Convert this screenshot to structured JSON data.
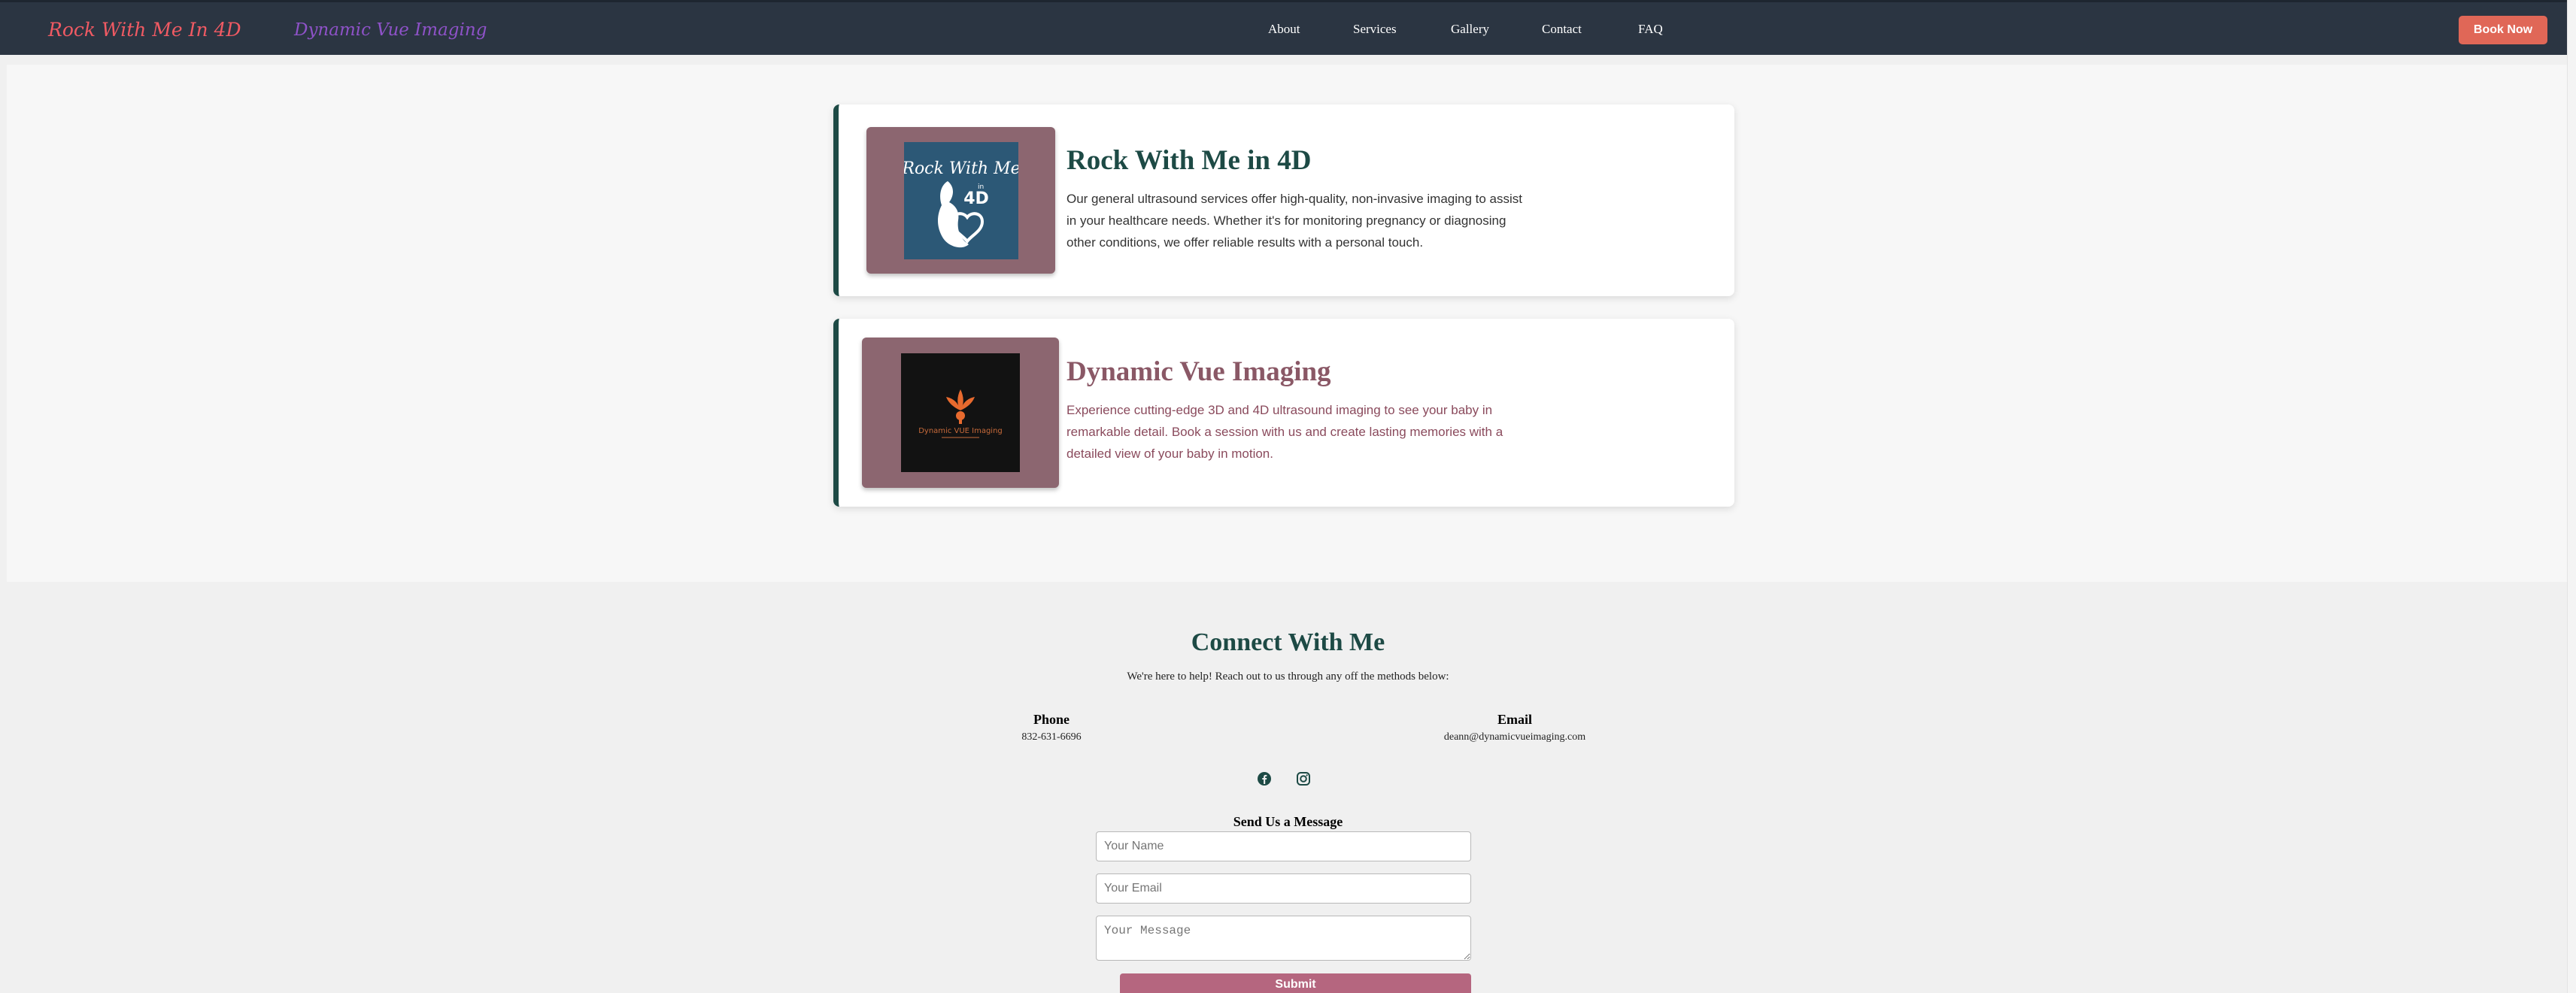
{
  "header": {
    "brand_primary": "Rock With Me In 4D",
    "brand_secondary": "Dynamic Vue Imaging",
    "nav": [
      "About",
      "Services",
      "Gallery",
      "Contact",
      "FAQ"
    ],
    "cta": "Book Now"
  },
  "services": [
    {
      "title": "Rock With Me in 4D",
      "description": "Our general ultrasound services offer high-quality, non-invasive imaging to assist in your healthcare needs. Whether it's for monitoring pregnancy or diagnosing other conditions, we offer reliable results with a personal touch.",
      "logo_text": [
        "Rock With Me",
        "in",
        "4D"
      ],
      "title_color": "#1d4a45",
      "text_color": "#333333"
    },
    {
      "title": "Dynamic Vue Imaging",
      "description": "Experience cutting-edge 3D and 4D ultrasound imaging to see your baby in remarkable detail. Book a session with us and create lasting memories with a detailed view of your baby in motion.",
      "logo_text": "Dynamic VUE Imaging",
      "title_color": "#8a5866",
      "text_color": "#8a4a5c"
    }
  ],
  "contact": {
    "title": "Connect With Me",
    "subtitle": "We're here to help! Reach out to us through any off the methods below:",
    "phone_label": "Phone",
    "phone": "832-631-6696",
    "email_label": "Email",
    "email": "deann@dynamicvueimaging.com",
    "social_icons": [
      "facebook-icon",
      "instagram-icon"
    ],
    "form_title": "Send Us a Message",
    "name_placeholder": "Your Name",
    "email_placeholder": "Your Email",
    "message_placeholder": "Your Message",
    "submit": "Submit"
  }
}
